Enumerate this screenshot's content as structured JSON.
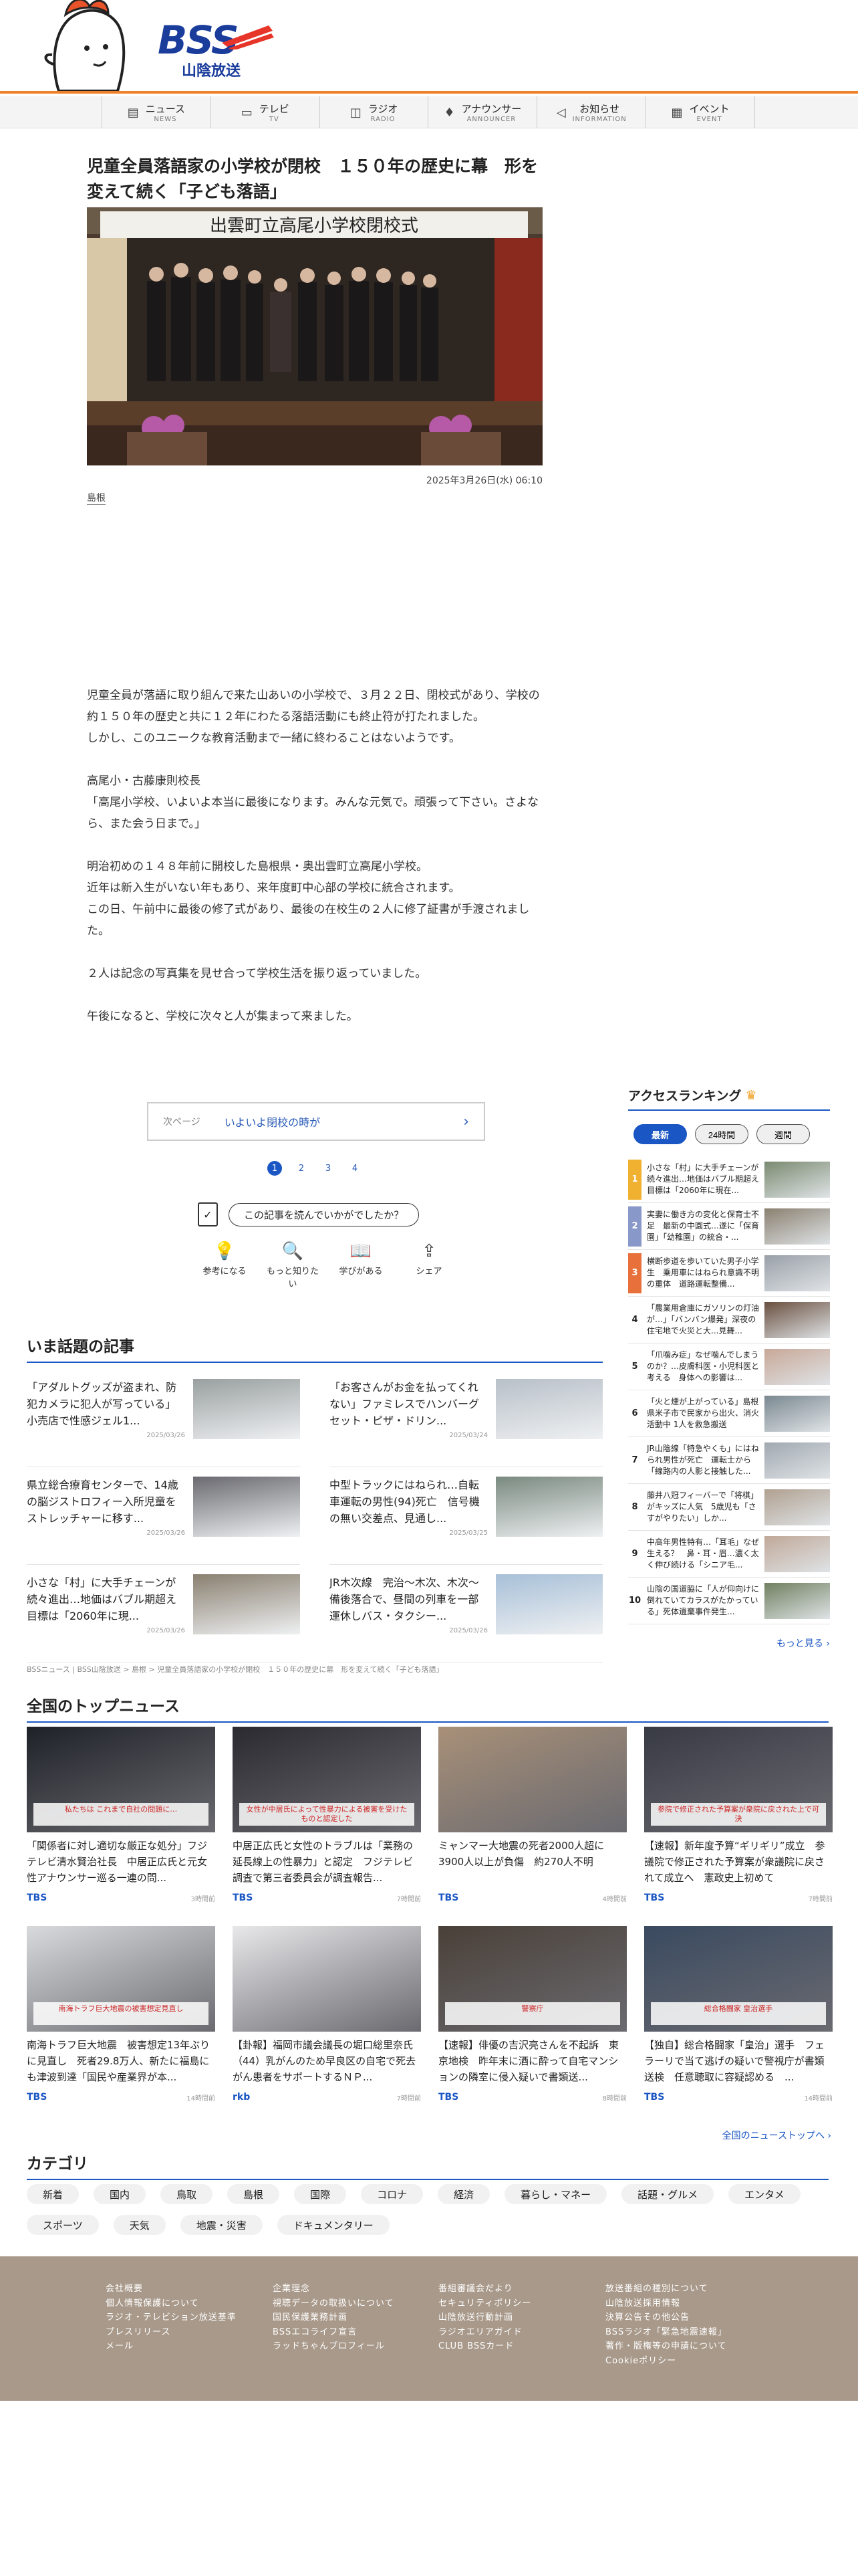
{
  "header": {
    "logo_main": "BSS",
    "logo_sub": "山陰放送"
  },
  "nav": [
    {
      "jp": "ニュース",
      "en": "NEWS",
      "icon": "newspaper-icon"
    },
    {
      "jp": "テレビ",
      "en": "TV",
      "icon": "tv-icon"
    },
    {
      "jp": "ラジオ",
      "en": "RADIO",
      "icon": "radio-icon"
    },
    {
      "jp": "アナウンサー",
      "en": "ANNOUNCER",
      "icon": "microphone-icon"
    },
    {
      "jp": "お知らせ",
      "en": "INFORMATION",
      "icon": "megaphone-icon"
    },
    {
      "jp": "イベント",
      "en": "EVENT",
      "icon": "calendar-icon"
    }
  ],
  "article": {
    "title": "児童全員落語家の小学校が閉校　１５０年の歴史に幕　形を変えて続く「子ども落語」",
    "banner_text": "出雲町立高尾小学校閉校式",
    "date": "2025年3月26日(水) 06:10",
    "tag": "島根",
    "paragraphs": [
      "児童全員が落語に取り組んで来た山あいの小学校で、３月２２日、閉校式があり、学校の約１５０年の歴史と共に１２年にわたる落語活動にも終止符が打たれました。\nしかし、このユニークな教育活動まで一緒に終わることはないようです。",
      "高尾小・古藤康則校長\n「高尾小学校、いよいよ本当に最後になります。みんな元気で。頑張って下さい。さよなら、また会う日まで。」",
      "明治初めの１４８年前に開校した島根県・奥出雲町立高尾小学校。\n近年は新入生がいない年もあり、来年度町中心部の学校に統合されます。\nこの日、午前中に最後の修了式があり、最後の在校生の２人に修了証書が手渡されました。",
      "２人は記念の写真集を見せ合って学校生活を振り返っていました。",
      "午後になると、学校に次々と人が集まって来ました。"
    ],
    "next_label": "次ページ",
    "next_title": "いよいよ閉校の時が",
    "pages": [
      "1",
      "2",
      "3",
      "4"
    ],
    "question": "この記事を読んでいかがでしたか？",
    "reactions": [
      {
        "label": "参考になる",
        "icon": "lightbulb-icon",
        "glyph": "💡"
      },
      {
        "label": "もっと知りたい",
        "icon": "magnifier-icon",
        "glyph": "🔍"
      },
      {
        "label": "学びがある",
        "icon": "book-icon",
        "glyph": "📖"
      },
      {
        "label": "シェア",
        "icon": "share-icon",
        "glyph": "⇪"
      }
    ]
  },
  "ranking": {
    "title": "アクセスランキング",
    "tabs": [
      "最新",
      "24時間",
      "週間"
    ],
    "items": [
      {
        "n": "1",
        "text": "小さな「村」に大手チェーンが続々進出…地価はバブル期超え　目標は「2060年に現在..."
      },
      {
        "n": "2",
        "text": "実妻に働き方の変化と保育士不足　最新の中園式…遂に「保育園」「幼稚園」の統合・..."
      },
      {
        "n": "3",
        "text": "横断歩道を歩いていた男子小学生　乗用車にはねられ意識不明の重体　道路運転整備..."
      },
      {
        "n": "4",
        "text": "「農業用倉庫にガソリンの灯油が…」「バンバン爆発」深夜の住宅地で火災と大...見舞..."
      },
      {
        "n": "5",
        "text": "「爪噛み症」なぜ噛んでしまうのか？…皮膚科医・小児科医と考える　身体への影響は..."
      },
      {
        "n": "6",
        "text": "「火と煙が上がっている」島根県米子市で民家から出火、消火活動中 1人を救急搬送"
      },
      {
        "n": "7",
        "text": "JR山陰線「特急やくも」にはねられ男性が死亡　運転士から「線路内の人影と接触した..."
      },
      {
        "n": "8",
        "text": "藤井八冠フィーバーで「将棋」がキッズに人気　5歳児も「さすがやりたい」しか..."
      },
      {
        "n": "9",
        "text": "中高年男性特有…「耳毛」なぜ生える？　鼻・耳・眉…濃く太く伸び続ける「シニア毛..."
      },
      {
        "n": "10",
        "text": "山陰の国道脇に「人が仰向けに倒れていてカラスがたかっている」死体遺棄事件発生..."
      }
    ],
    "more": "もっと見る ›"
  },
  "topics": {
    "title": "いま話題の記事",
    "items": [
      {
        "text": "「アダルトグッズが盗まれ、防犯カメラに犯人が写っている」小売店で性感ジェル1...",
        "date": "2025/03/26"
      },
      {
        "text": "「お客さんがお金を払ってくれない」ファミレスでハンバーグセット・ピザ・ドリン...",
        "date": "2025/03/24"
      },
      {
        "text": "県立総合療育センターで、14歳の脳ジストロフィー入所児童をストレッチャーに移す...",
        "date": "2025/03/26"
      },
      {
        "text": "中型トラックにはねられ…自転車運転の男性(94)死亡　信号機の無い交差点、見通し...",
        "date": "2025/03/25"
      },
      {
        "text": "小さな「村」に大手チェーンが続々進出…地価はバブル期超え　目標は「2060年に現...",
        "date": "2025/03/26"
      },
      {
        "text": "JR木次線　完治〜木次、木次〜備後落合で、昼間の列車を一部運休しバス・タクシー...",
        "date": "2025/03/26"
      }
    ]
  },
  "breadcrumb": "BSSニュース | BSS山陰放送 > 島根 > 児童全員落語家の小学校が閉校　１５０年の歴史に幕　形を変えて続く「子ども落語」",
  "national": {
    "title": "全国のトップニュース",
    "items": [
      {
        "text": "「関係者に対し適切な厳正な処分」フジテレビ清水賢治社長　中居正広氏と元女性アナウンサー巡る一連の問...",
        "src": "TBS",
        "ago": "3時間前",
        "cap": "私たちは これまで自社の問題に…"
      },
      {
        "text": "中居正広氏と女性のトラブルは「業務の延長線上の性暴力」と認定　フジテレビ調査で第三者委員会が調査報告...",
        "src": "TBS",
        "ago": "7時間前",
        "cap": "女性が中居氏によって性暴力による被害を受けたものと認定した"
      },
      {
        "text": "ミャンマー大地震の死者2000人超に 3900人以上が負傷　約270人不明",
        "src": "TBS",
        "ago": "4時間前",
        "cap": ""
      },
      {
        "text": "【速報】新年度予算“ギリギリ”成立　参議院で修正された予算案が衆議院に戻されて成立へ　憲政史上初めて",
        "src": "TBS",
        "ago": "7時間前",
        "cap": "参院で修正された予算案が衆院に戻された上で可決"
      },
      {
        "text": "南海トラフ巨大地震　被害想定13年ぶりに見直し　死者29.8万人、新たに福島にも津波到達「国民や産業界が本...",
        "src": "TBS",
        "ago": "14時間前",
        "cap": "南海トラフ巨大地震の被害想定見直し"
      },
      {
        "text": "【卦報】福岡市議会議長の堀口総里奈氏（44）乳がんのため早良区の自宅で死去　がん患者をサポートするＮＰ...",
        "src": "rkb",
        "ago": "7時間前",
        "cap": ""
      },
      {
        "text": "【速報】俳優の吉沢亮さんを不起訴　東京地検　昨年末に酒に酔って自宅マンションの隣室に侵入疑いで書類送...",
        "src": "TBS",
        "ago": "8時間前",
        "cap": "警察庁"
      },
      {
        "text": "【独自】総合格闘家「皇治」選手　フェラーリで当て逃げの疑いで警視庁が書類送検　任意聴取に容疑認める　...",
        "src": "TBS",
        "ago": "14時間前",
        "cap": "総合格闘家 皇治選手"
      }
    ],
    "all_link": "全国のニューストップへ ›"
  },
  "categories": {
    "title": "カテゴリ",
    "items": [
      "新着",
      "国内",
      "鳥取",
      "島根",
      "国際",
      "コロナ",
      "経済",
      "暮らし・マネー",
      "話題・グルメ",
      "エンタメ",
      "スポーツ",
      "天気",
      "地震・災害",
      "ドキュメンタリー"
    ]
  },
  "footer": {
    "col1": [
      "会社概要",
      "個人情報保護について",
      "ラジオ・テレビション放送基準",
      "プレスリリース",
      "メール"
    ],
    "col2": [
      "企業理念",
      "視聴データの取扱いについて",
      "国民保護業務計画",
      "BSSエコライフ宣言",
      "ラッドちゃんプロフィール"
    ],
    "col3": [
      "番組審議会だより",
      "セキュリティポリシー",
      "山陰放送行動計画",
      "ラジオエリアガイド",
      "CLUB BSSカード"
    ],
    "col4": [
      "放送番組の種別について",
      "山陰放送採用情報",
      "決算公告その他公告",
      "BSSラジオ「緊急地震速報」",
      "著作・版権等の申請について",
      "Cookieポリシー"
    ]
  },
  "colors": {
    "accent": "#1a56c4",
    "brand_orange": "#f0802a",
    "footer_bg": "#a8998a"
  }
}
